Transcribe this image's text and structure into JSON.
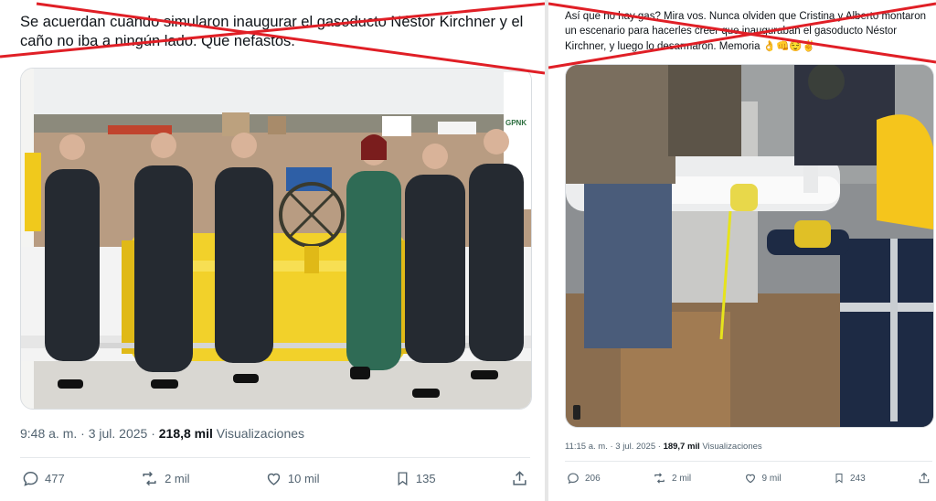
{
  "left_tweet": {
    "text": "Se acuerdan cuando simularon inaugurar el gasoducto Néstor Kirchner y el caño no iba a ningún lado. Que nefastos.",
    "time": "9:48 a. m. · 3 jul. 2025 · ",
    "views_count": "218,8 mil",
    "views_label": " Visualizaciones",
    "image_sign_text": "GPNK",
    "actions": {
      "replies": "477",
      "retweets": "2 mil",
      "likes": "10 mil",
      "bookmarks": "135"
    }
  },
  "right_tweet": {
    "text": "Así que no hay gas? Mira vos. Nunca olviden que Cristina y Alberto montaron un escenario para hacerles creer que inauguraban el gasoducto Néstor Kirchner, y luego lo desarmaron. Memoria 👌👊😌✌",
    "time": "11:15 a. m. · 3 jul. 2025 · ",
    "views_count": "189,7 mil",
    "views_label": " Visualizaciones",
    "actions": {
      "replies": "206",
      "retweets": "2 mil",
      "likes": "9 mil",
      "bookmarks": "243"
    }
  },
  "colors": {
    "cross_red": "#e01f26",
    "text_secondary": "#536471",
    "pipe_yellow": "#f2d12a"
  },
  "icons": [
    "reply-icon",
    "retweet-icon",
    "like-icon",
    "bookmark-icon",
    "share-icon"
  ]
}
